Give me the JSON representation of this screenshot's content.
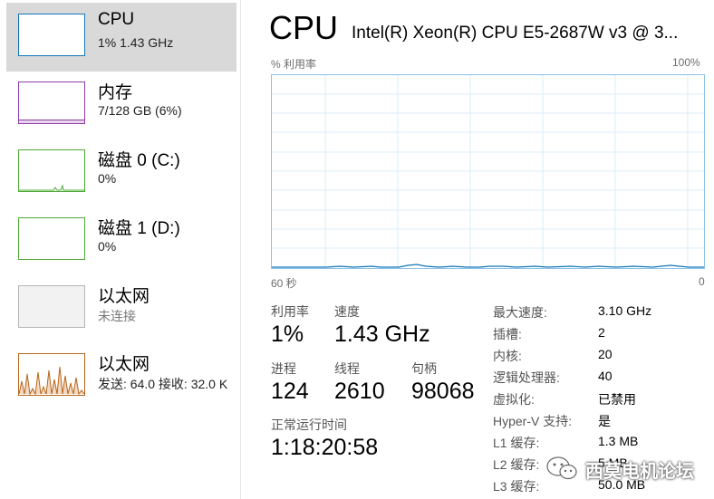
{
  "sidebar": {
    "items": [
      {
        "title": "CPU",
        "subtitle": "1% 1.43 GHz"
      },
      {
        "title": "内存",
        "subtitle": "7/128 GB (6%)"
      },
      {
        "title": "磁盘 0 (C:)",
        "subtitle": "0%"
      },
      {
        "title": "磁盘 1 (D:)",
        "subtitle": "0%"
      },
      {
        "title": "以太网",
        "subtitle": "未连接"
      },
      {
        "title": "以太网",
        "subtitle": "发送: 64.0  接收: 32.0 K"
      }
    ],
    "colors": {
      "cpu": "#1177bb",
      "memory": "#8b3aa8",
      "disk": "#4da935",
      "ethernet_off": "#b5b5b5",
      "ethernet": "#b8651b"
    }
  },
  "header": {
    "title": "CPU",
    "model": "Intel(R) Xeon(R) CPU E5-2687W v3 @ 3..."
  },
  "graph": {
    "y_label": "% 利用率",
    "y_max_label": "100%",
    "x_left_label": "60 秒",
    "x_right_label": "0",
    "border_color": "#8dc2e8",
    "grid_color": "#d9ecf7",
    "line_color": "#1177bb"
  },
  "stats": {
    "utilization": {
      "label": "利用率",
      "value": "1%"
    },
    "speed": {
      "label": "速度",
      "value": "1.43 GHz"
    },
    "processes": {
      "label": "进程",
      "value": "124"
    },
    "threads": {
      "label": "线程",
      "value": "2610"
    },
    "handles": {
      "label": "句柄",
      "value": "98068"
    },
    "uptime": {
      "label": "正常运行时间",
      "value": "1:18:20:58"
    }
  },
  "specs": [
    {
      "key": "最大速度:",
      "value": "3.10 GHz"
    },
    {
      "key": "插槽:",
      "value": "2"
    },
    {
      "key": "内核:",
      "value": "20"
    },
    {
      "key": "逻辑处理器:",
      "value": "40"
    },
    {
      "key": "虚拟化:",
      "value": "已禁用"
    },
    {
      "key": "Hyper-V 支持:",
      "value": "是"
    },
    {
      "key": "L1 缓存:",
      "value": "1.3 MB"
    },
    {
      "key": "L2 缓存:",
      "value": "5 MB"
    },
    {
      "key": "L3 缓存:",
      "value": "50.0 MB"
    }
  ],
  "watermark": {
    "text": "西莫电机论坛"
  }
}
